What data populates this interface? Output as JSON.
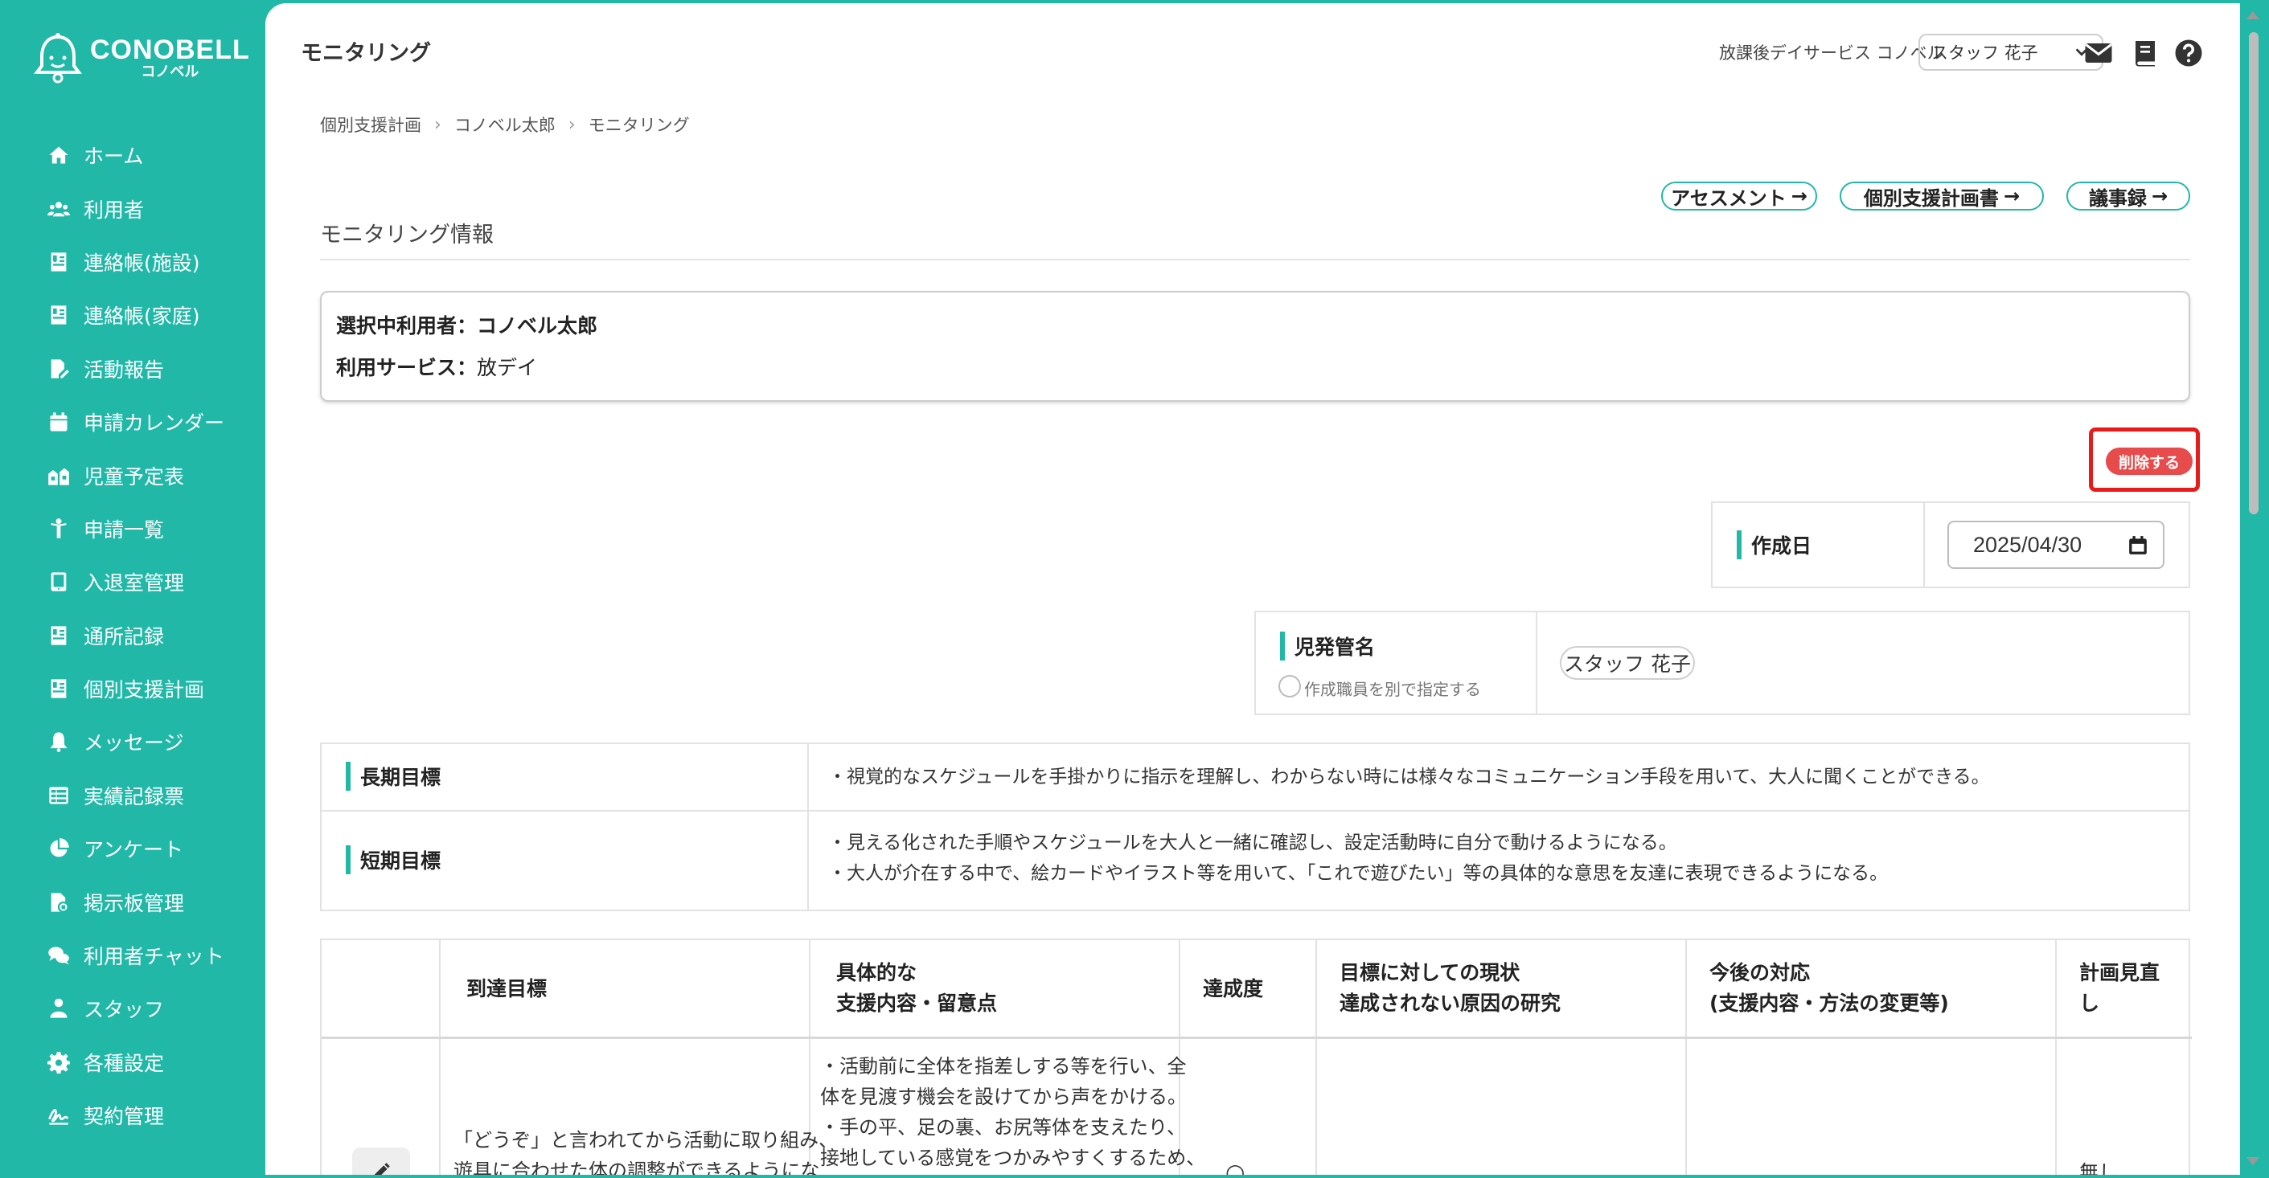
{
  "brand": {
    "name": "CONOBELL",
    "sub": "コノベル"
  },
  "sidebar": {
    "items": [
      {
        "label": "ホーム",
        "icon": "home-icon"
      },
      {
        "label": "利用者",
        "icon": "users-icon"
      },
      {
        "label": "連絡帳(施設)",
        "icon": "contact-card-icon"
      },
      {
        "label": "連絡帳(家庭)",
        "icon": "contact-card-icon"
      },
      {
        "label": "活動報告",
        "icon": "report-edit-icon"
      },
      {
        "label": "申請カレンダー",
        "icon": "calendar-icon"
      },
      {
        "label": "児童予定表",
        "icon": "building-icon"
      },
      {
        "label": "申請一覧",
        "icon": "child-icon"
      },
      {
        "label": "入退室管理",
        "icon": "tablet-icon"
      },
      {
        "label": "通所記録",
        "icon": "contact-card-icon"
      },
      {
        "label": "個別支援計画",
        "icon": "contact-card-icon"
      },
      {
        "label": "メッセージ",
        "icon": "bell-icon"
      },
      {
        "label": "実績記録票",
        "icon": "table-icon"
      },
      {
        "label": "アンケート",
        "icon": "pie-chart-icon"
      },
      {
        "label": "掲示板管理",
        "icon": "file-image-icon"
      },
      {
        "label": "利用者チャット",
        "icon": "chat-icon"
      },
      {
        "label": "スタッフ",
        "icon": "staff-icon"
      },
      {
        "label": "各種設定",
        "icon": "gear-icon"
      },
      {
        "label": "契約管理",
        "icon": "signature-icon"
      }
    ]
  },
  "header": {
    "title": "モニタリング",
    "facility": "放課後デイサービス コノベル",
    "staff_selected": "スタッフ 花子"
  },
  "breadcrumb": [
    "個別支援計画",
    "コノベル太郎",
    "モニタリング"
  ],
  "links": {
    "assessment": "アセスメント",
    "plan": "個別支援計画書",
    "minutes": "議事録",
    "arrow": "→"
  },
  "section": {
    "title": "モニタリング情報"
  },
  "info": {
    "user_label": "選択中利用者：",
    "user_value": "コノベル太郎",
    "service_label": "利用サービス：",
    "service_value": "放デイ"
  },
  "delete_label": "削除する",
  "created": {
    "label": "作成日",
    "value": "2025/04/30"
  },
  "manager": {
    "label": "児発管名",
    "radio_label": "作成職員を別で指定する",
    "value": "スタッフ 花子"
  },
  "goals": {
    "long_label": "長期目標",
    "long_text": "・視覚的なスケジュールを手掛かりに指示を理解し、わからない時には様々なコミュニケーション手段を用いて、大人に聞くことができる。",
    "short_label": "短期目標",
    "short_text_1": "・見える化された手順やスケジュールを大人と一緒に確認し、設定活動時に自分で動けるようになる。",
    "short_text_2": "・大人が介在する中で、絵カードやイラスト等を用いて、「これで遊びたい」等の具体的な意思を友達に表現できるようになる。"
  },
  "table": {
    "headers": {
      "target": "到達目標",
      "support_1": "具体的な",
      "support_2": "支援内容・留意点",
      "achievement": "達成度",
      "status_1": "目標に対しての現状",
      "status_2": "達成されない原因の研究",
      "future_1": "今後の対応",
      "future_2": "(支援内容・方法の変更等)",
      "review_1": "計画見直",
      "review_2": "し"
    },
    "row": {
      "target_1": "「どうぞ」と言われてから活動に取り組み、",
      "target_2": "遊具に合わせた体の調整ができるようにな",
      "support_1": "・活動前に全体を指差しする等を行い、全",
      "support_2": "体を見渡す機会を設けてから声をかける。",
      "support_3": "・手の平、足の裏、お尻等体を支えたり、",
      "support_4": "接地している感覚をつかみやすくするため、",
      "achievement": "○",
      "review": "無し"
    }
  }
}
